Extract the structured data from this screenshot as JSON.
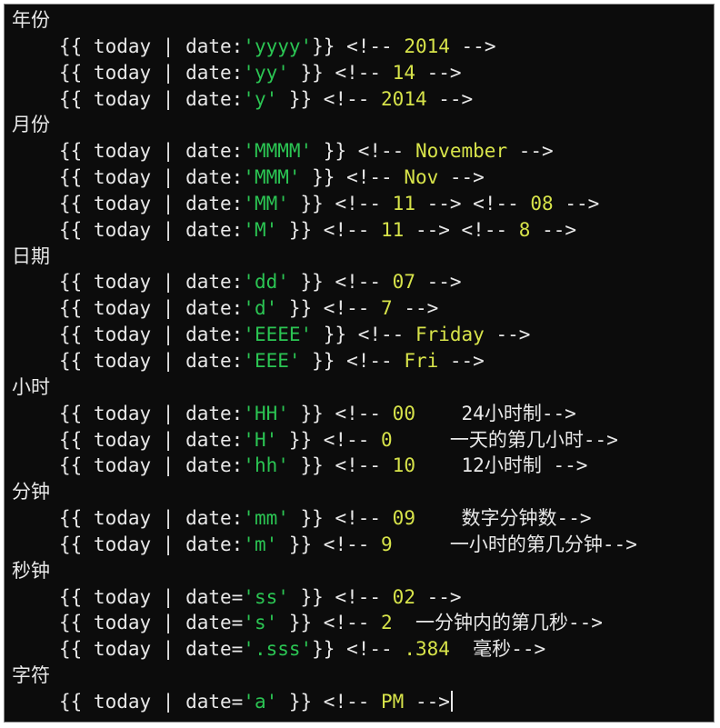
{
  "editor": {
    "sections": [
      {
        "heading": "年份",
        "lines": [
          {
            "pre": "{{ today | date:",
            "fmt": "'yyyy'",
            "post": "}} <!-- ",
            "val": "2014",
            "note": "",
            "end": " -->"
          },
          {
            "pre": "{{ today | date:",
            "fmt": "'yy'",
            "post": " }} <!-- ",
            "val": "14",
            "note": "",
            "end": " -->"
          },
          {
            "pre": "{{ today | date:",
            "fmt": "'y'",
            "post": " }} <!-- ",
            "val": "2014",
            "note": "",
            "end": " -->"
          }
        ]
      },
      {
        "heading": "月份",
        "lines": [
          {
            "pre": "{{ today | date:",
            "fmt": "'MMMM'",
            "post": " }} <!-- ",
            "val": "November",
            "note": "",
            "end": " -->"
          },
          {
            "pre": "{{ today | date:",
            "fmt": "'MMM'",
            "post": " }} <!-- ",
            "val": "Nov",
            "note": "",
            "end": " -->"
          },
          {
            "pre": "{{ today | date:",
            "fmt": "'MM'",
            "post": " }} <!-- ",
            "val": "11",
            "note": "",
            "end": " --> <!-- ",
            "val2": "08",
            "end2": " -->"
          },
          {
            "pre": "{{ today | date:",
            "fmt": "'M'",
            "post": " }} <!-- ",
            "val": "11",
            "note": "",
            "end": " --> <!-- ",
            "val2": "8",
            "end2": " -->"
          }
        ]
      },
      {
        "heading": "日期",
        "lines": [
          {
            "pre": "{{ today | date:",
            "fmt": "'dd'",
            "post": " }} <!-- ",
            "val": "07",
            "note": "",
            "end": " -->"
          },
          {
            "pre": "{{ today | date:",
            "fmt": "'d'",
            "post": " }} <!-- ",
            "val": "7",
            "note": "",
            "end": " -->"
          },
          {
            "pre": "{{ today | date:",
            "fmt": "'EEEE'",
            "post": " }} <!-- ",
            "val": "Friday",
            "note": "",
            "end": " -->"
          },
          {
            "pre": "{{ today | date:",
            "fmt": "'EEE'",
            "post": " }} <!-- ",
            "val": "Fri",
            "note": "",
            "end": " -->"
          }
        ]
      },
      {
        "heading": "小时",
        "lines": [
          {
            "pre": "{{ today | date:",
            "fmt": "'HH'",
            "post": " }} <!-- ",
            "val": "00",
            "note": "    24小时制",
            "end": "-->"
          },
          {
            "pre": "{{ today | date:",
            "fmt": "'H'",
            "post": " }} <!-- ",
            "val": "0",
            "note": "     一天的第几小时",
            "end": "-->"
          },
          {
            "pre": "{{ today | date:",
            "fmt": "'hh'",
            "post": " }} <!-- ",
            "val": "10",
            "note": "    12小时制",
            "end": " -->"
          }
        ]
      },
      {
        "heading": "分钟",
        "lines": [
          {
            "pre": "{{ today | date:",
            "fmt": "'mm'",
            "post": " }} <!-- ",
            "val": "09",
            "note": "    数字分钟数",
            "end": "-->"
          },
          {
            "pre": "{{ today | date:",
            "fmt": "'m'",
            "post": " }} <!-- ",
            "val": "9",
            "note": "     一小时的第几分钟",
            "end": "-->"
          }
        ]
      },
      {
        "heading": "秒钟",
        "lines": [
          {
            "pre": "{{ today | date=",
            "fmt": "'ss'",
            "post": " }} <!-- ",
            "val": "02",
            "note": "",
            "end": " -->"
          },
          {
            "pre": "{{ today | date=",
            "fmt": "'s'",
            "post": " }} <!-- ",
            "val": "2",
            "note": "  一分钟内的第几秒",
            "end": "-->"
          },
          {
            "pre": "{{ today | date=",
            "fmt": "'.sss'",
            "post": "}} <!-- ",
            "val": ".384",
            "note": "  毫秒",
            "end": "-->"
          }
        ]
      },
      {
        "heading": "字符",
        "lines": [
          {
            "pre": "{{ today | date=",
            "fmt": "'a'",
            "post": " }} <!-- ",
            "val": "PM",
            "note": "",
            "end": " -->",
            "cursor": true
          }
        ]
      }
    ]
  }
}
